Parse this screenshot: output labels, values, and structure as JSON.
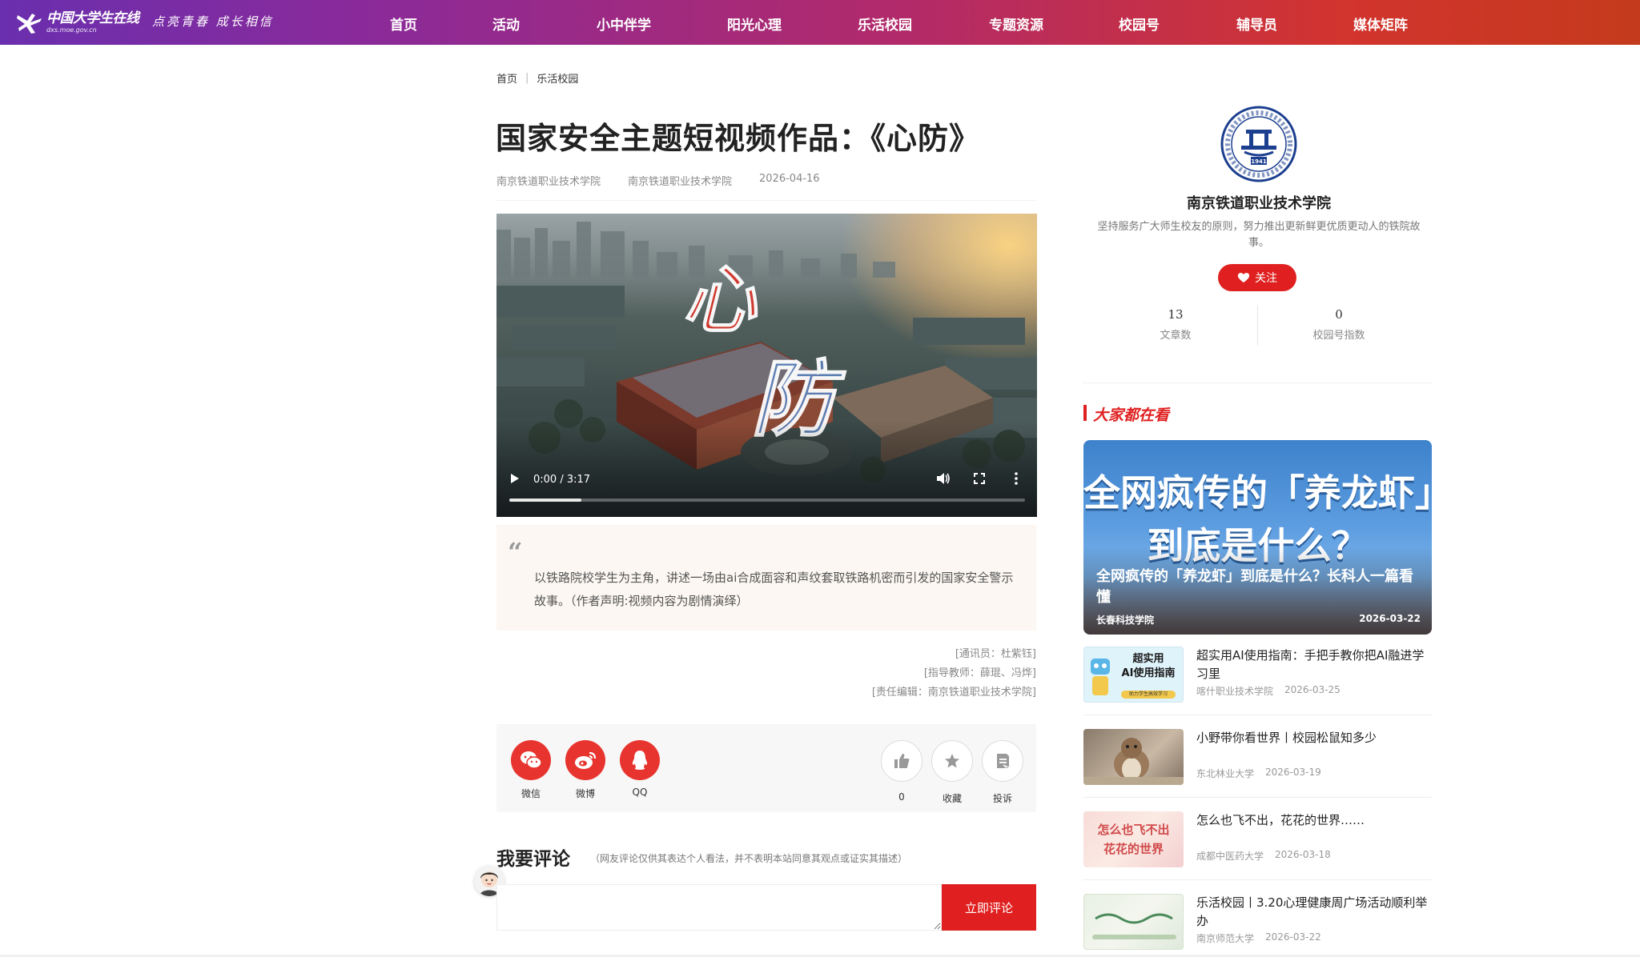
{
  "header": {
    "logo_text": "中国大学生在线",
    "logo_sub": "dxs.moe.gov.cn",
    "slogan": "点亮青春 成长相信",
    "nav": [
      "首页",
      "活动",
      "小中伴学",
      "阳光心理",
      "乐活校园",
      "专题资源",
      "校园号",
      "辅导员",
      "媒体矩阵"
    ]
  },
  "breadcrumb": [
    "首页",
    "乐活校园"
  ],
  "article": {
    "title": "国家安全主题短视频作品：《心防》",
    "author": "南京铁道职业技术学院",
    "source": "南京铁道职业技术学院",
    "date": "2026-04-16",
    "video": {
      "time": "0:00 / 3:17",
      "progress": 0.14,
      "overlay_text_1": "心",
      "overlay_text_2": "防"
    },
    "summary": "以铁路院校学生为主角，讲述一场由ai合成面容和声纹套取铁路机密而引发的国家安全警示故事。（作者声明:视频内容为剧情演绎）",
    "credits": [
      "[通讯员：杜紫钰]",
      "[指导教师：薛琨、冯烨]",
      "[责任编辑：南京铁道职业技术学院]"
    ]
  },
  "share": {
    "items": [
      {
        "label": "微信",
        "icon": "wechat-icon",
        "color": "#e8342e"
      },
      {
        "label": "微博",
        "icon": "weibo-icon",
        "color": "#e8342e"
      },
      {
        "label": "QQ",
        "icon": "qq-icon",
        "color": "#e8342e"
      }
    ],
    "actions": [
      {
        "label": "0",
        "icon": "thumbs-up-icon"
      },
      {
        "label": "收藏",
        "icon": "star-icon"
      },
      {
        "label": "投诉",
        "icon": "report-icon"
      }
    ]
  },
  "comment": {
    "title": "我要评论",
    "note": "（网友评论仅供其表达个人看法，并不表明本站同意其观点或证实其描述）",
    "input_value": "",
    "submit_label": "立即评论"
  },
  "sidebar": {
    "school_name": "南京铁道职业技术学院",
    "school_logo_year": "1941",
    "school_desc": "坚持服务广大师生校友的原则，努力推出更新鲜更优质更动人的铁院故事。",
    "follow_label": "关注",
    "stats": [
      {
        "value": "13",
        "label": "文章数"
      },
      {
        "value": "0",
        "label": "校园号指数"
      }
    ],
    "section_title": "大家都在看",
    "feature": {
      "big_line_1": "全网疯传的「养龙虾」",
      "big_line_2": "到底是什么？",
      "title": "全网疯传的「养龙虾」到底是什么？长科人一篇看懂",
      "source": "长春科技学院",
      "date": "2026-03-22"
    },
    "news": [
      {
        "title": "超实用AI使用指南：手把手教你把AI融进学习里",
        "source": "喀什职业技术学院",
        "date": "2026-03-25",
        "thumb_line_1": "超实用",
        "thumb_line_2": "AI使用指南",
        "thumb_tag": "助力学生高效学习"
      },
      {
        "title": "小野带你看世界丨校园松鼠知多少",
        "source": "东北林业大学",
        "date": "2026-03-19"
      },
      {
        "title": "怎么也飞不出，花花的世界……",
        "source": "成都中医药大学",
        "date": "2026-03-18",
        "thumb_line_1": "怎么也飞不出",
        "thumb_line_2": "花花的世界"
      },
      {
        "title": "乐活校园丨3.20心理健康周广场活动顺利举办",
        "source": "南京师范大学",
        "date": "2026-03-22"
      }
    ]
  },
  "colors": {
    "accent": "#e02020",
    "nav_start": "#6a2fae",
    "nav_end": "#c43a1c",
    "quote_bg": "#fcf7f2"
  }
}
